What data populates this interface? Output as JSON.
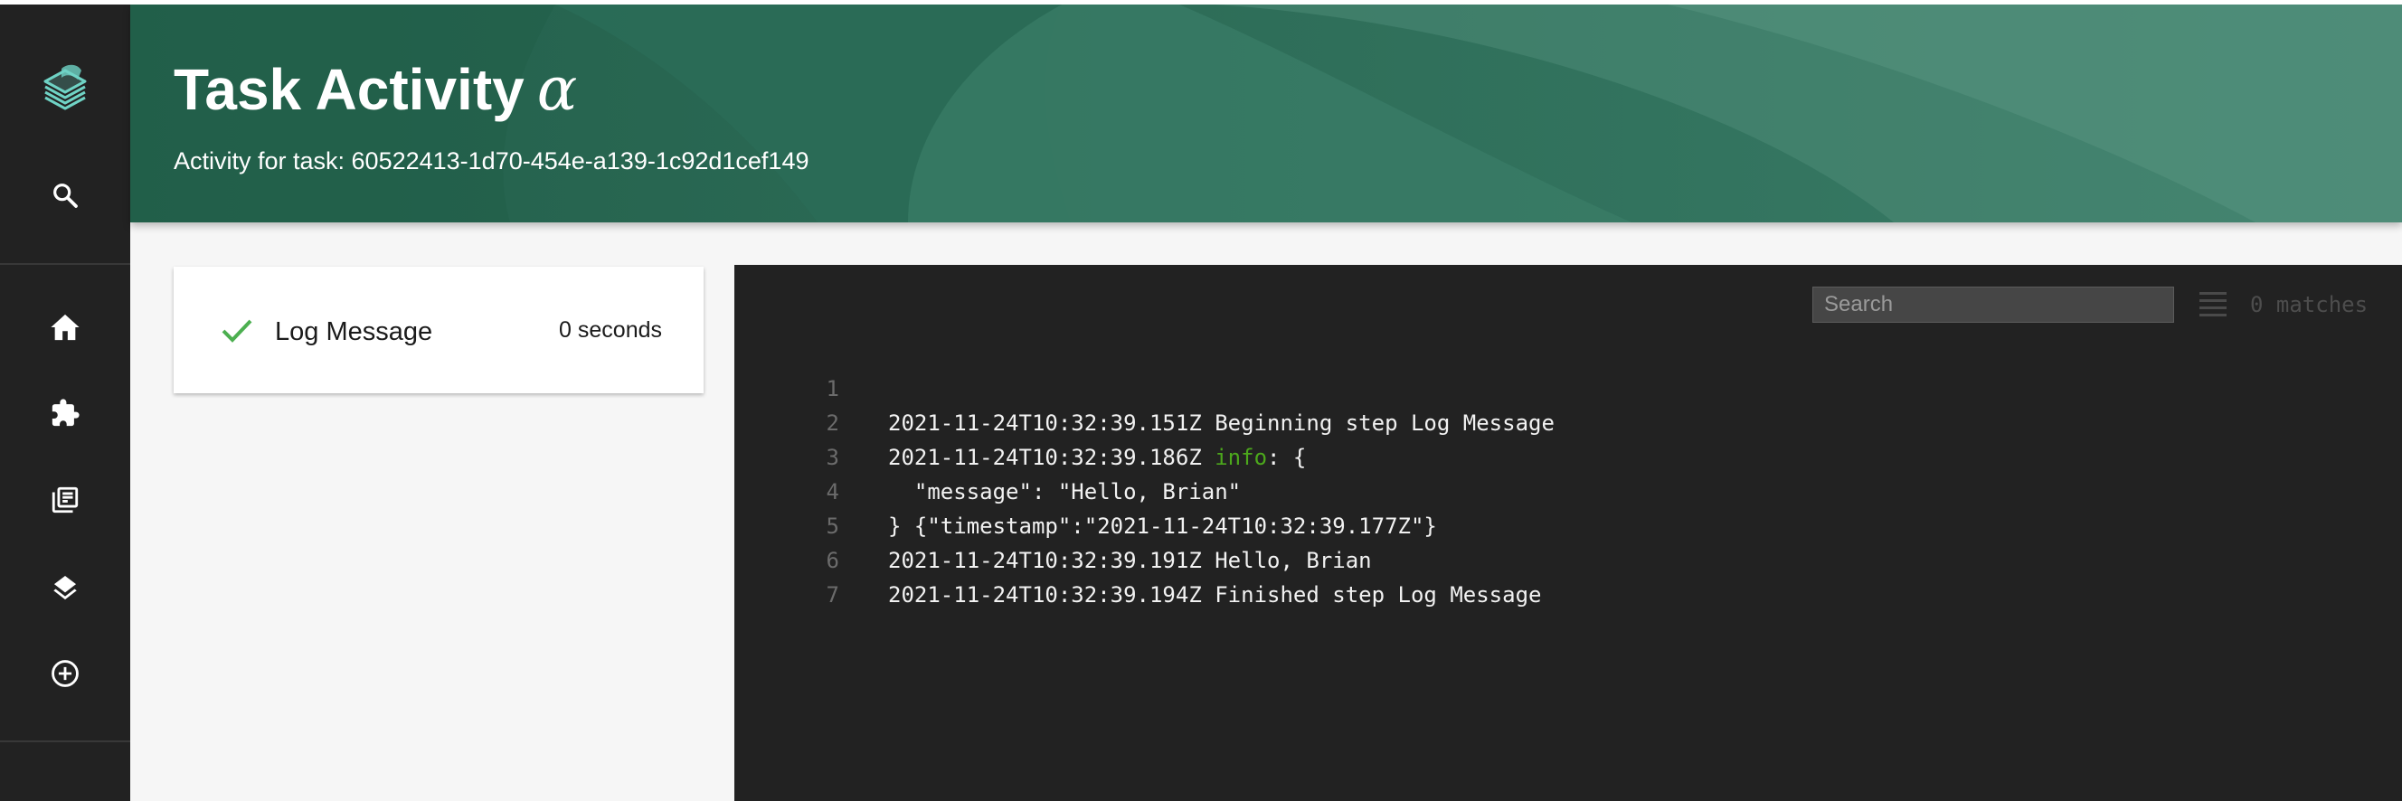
{
  "header": {
    "title": "Task Activity",
    "alpha": "α",
    "subtitle": "Activity for task: 60522413-1d70-454e-a139-1c92d1cef149"
  },
  "sidebar": {
    "items": [
      {
        "icon": "logo-icon"
      },
      {
        "icon": "search-icon"
      },
      {
        "icon": "home-icon"
      },
      {
        "icon": "puzzle-icon"
      },
      {
        "icon": "library-icon"
      },
      {
        "icon": "layers-icon"
      },
      {
        "icon": "add-circle-icon"
      }
    ]
  },
  "steps": [
    {
      "name": "Log Message",
      "duration": "0 seconds",
      "status": "success"
    }
  ],
  "log": {
    "search_placeholder": "Search",
    "matches": "0 matches",
    "lines": [
      {
        "num": "1",
        "text": "2021-11-24T10:32:39.151Z Beginning step Log Message"
      },
      {
        "num": "2",
        "prefix": "2021-11-24T10:32:39.186Z ",
        "level": "info",
        "rest": ": {"
      },
      {
        "num": "3",
        "text": "  \"message\": \"Hello, Brian\""
      },
      {
        "num": "4",
        "text": "} {\"timestamp\":\"2021-11-24T10:32:39.177Z\"}"
      },
      {
        "num": "5",
        "text": "2021-11-24T10:32:39.191Z Hello, Brian"
      },
      {
        "num": "6",
        "text": "2021-11-24T10:32:39.194Z Finished step Log Message"
      },
      {
        "num": "7",
        "text": ""
      }
    ]
  },
  "colors": {
    "accent": "#2d6b56",
    "success": "#4caf50",
    "info": "#4ca81c",
    "sidebar": "#222222"
  }
}
